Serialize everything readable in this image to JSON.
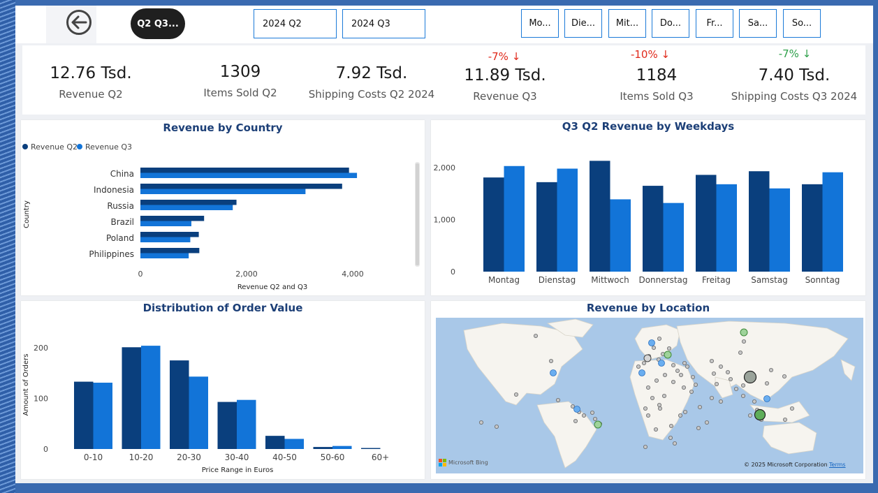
{
  "toolbar": {
    "back_icon": "back-arrow-icon",
    "quarter_pill": "Q2 Q3...",
    "slicer_q2": "2024 Q2",
    "slicer_q3": "2024 Q3",
    "days": [
      "Mo...",
      "Die...",
      "Mit...",
      "Do...",
      "Fr...",
      "Sa...",
      "So..."
    ]
  },
  "kpis": [
    {
      "value": "12.76 Tsd.",
      "label": "Revenue Q2"
    },
    {
      "value": "1309",
      "label": "Items Sold Q2"
    },
    {
      "value": "7.92 Tsd.",
      "label": "Shipping Costs Q2 2024"
    },
    {
      "value": "11.89 Tsd.",
      "label": "Revenue Q3",
      "delta": "-7% ↓"
    },
    {
      "value": "1184",
      "label": "Items Sold Q3",
      "delta": "-10% ↓"
    },
    {
      "value": "7.40 Tsd.",
      "label": "Shipping Costs Q3 2024",
      "delta": "-7% ↓"
    }
  ],
  "colors": {
    "q2": "#0a3f7d",
    "q3": "#1274d8",
    "delta_bad": "#e0291b",
    "delta_good": "#2ea04a"
  },
  "chart_data": [
    {
      "type": "bar",
      "orientation": "horizontal",
      "title": "Revenue by Country",
      "xlabel": "Revenue Q2 and Q3",
      "ylabel": "Country",
      "categories": [
        "China",
        "Indonesia",
        "Russia",
        "Brazil",
        "Poland",
        "Philippines"
      ],
      "series": [
        {
          "name": "Revenue Q2",
          "values": [
            3930,
            3800,
            1810,
            1200,
            1100,
            1110
          ]
        },
        {
          "name": "Revenue Q3",
          "values": [
            4080,
            3110,
            1740,
            960,
            940,
            910
          ]
        }
      ],
      "xticks": [
        "0",
        "2,000",
        "4,000"
      ],
      "xlim": [
        0,
        4200
      ],
      "legend": "top-left"
    },
    {
      "type": "bar",
      "title": "Q3 Q2 Revenue by Weekdays",
      "categories": [
        "Montag",
        "Dienstag",
        "Mittwoch",
        "Donnerstag",
        "Freitag",
        "Samstag",
        "Sonntag"
      ],
      "series": [
        {
          "name": "Revenue Q2",
          "values": [
            1810,
            1720,
            2130,
            1650,
            1860,
            1930,
            1680
          ]
        },
        {
          "name": "Revenue Q3",
          "values": [
            2030,
            1980,
            1390,
            1320,
            1680,
            1600,
            1910
          ]
        }
      ],
      "yticks": [
        "0",
        "1,000",
        "2,000"
      ],
      "ylim": [
        0,
        2300
      ]
    },
    {
      "type": "bar",
      "title": "Distribution of Order Value",
      "xlabel": "Price Range in Euros",
      "ylabel": "Amount of Orders",
      "categories": [
        "0-10",
        "10-20",
        "20-30",
        "30-40",
        "40-50",
        "50-60",
        "60+"
      ],
      "series": [
        {
          "name": "Revenue Q2",
          "values": [
            133,
            201,
            175,
            93,
            26,
            4,
            2
          ]
        },
        {
          "name": "Revenue Q3",
          "values": [
            131,
            204,
            143,
            97,
            20,
            6,
            0
          ]
        }
      ],
      "yticks": [
        "0",
        "100",
        "200"
      ],
      "ylim": [
        0,
        230
      ]
    }
  ],
  "map": {
    "title": "Revenue by Location",
    "bing_logo": "Microsoft Bing",
    "copyright": "© 2025 Microsoft Corporation",
    "terms": "Terms"
  }
}
